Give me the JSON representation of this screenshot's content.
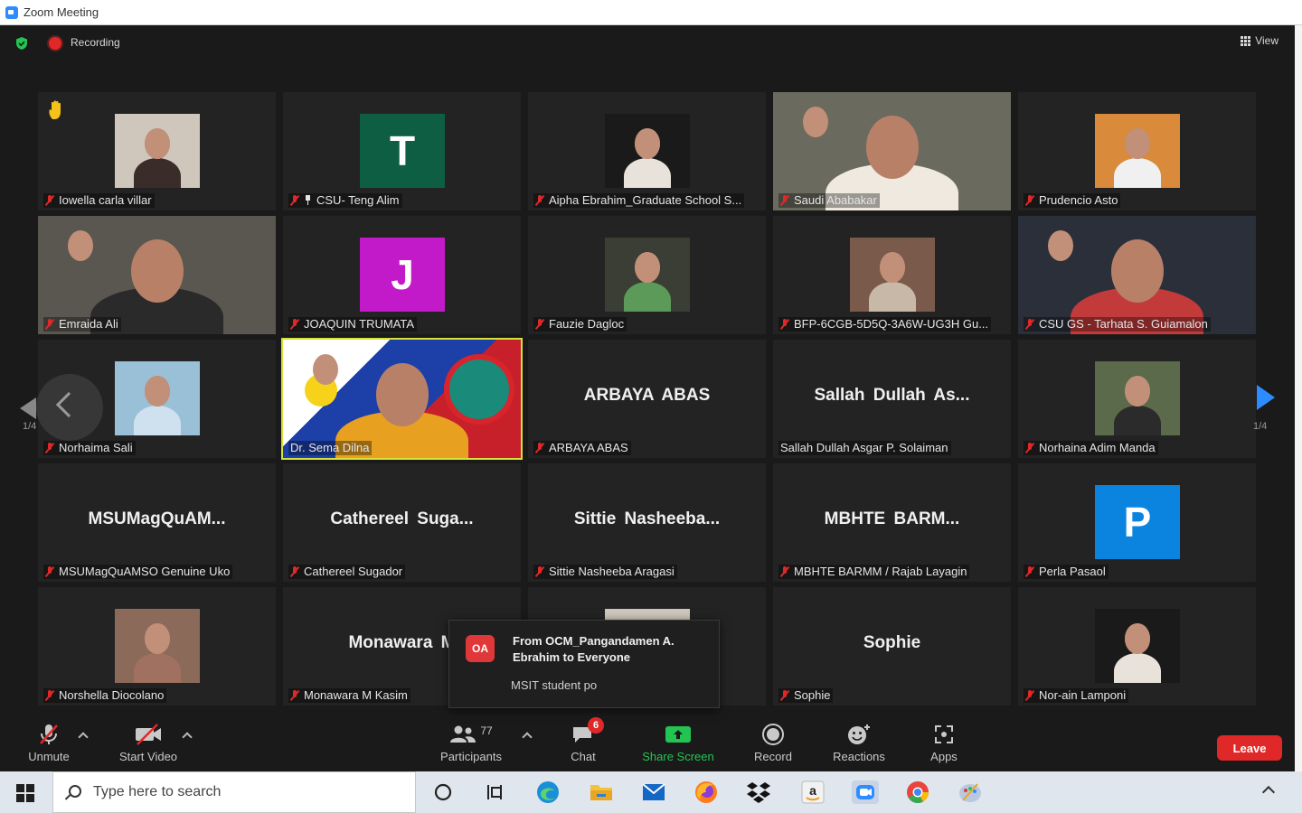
{
  "window": {
    "title": "Zoom Meeting"
  },
  "topbar": {
    "recording_label": "Recording",
    "view_label": "View"
  },
  "participants_grid": [
    {
      "name": "Iowella carla villar",
      "type": "photo",
      "raised_hand": true,
      "muted": true
    },
    {
      "name": "CSU- Teng Alim",
      "type": "letter",
      "letter": "T",
      "color": "#0e5e44",
      "muted": true,
      "pinned": true
    },
    {
      "name": "Aipha Ebrahim_Graduate School S...",
      "type": "photo",
      "muted": true
    },
    {
      "name": "Saudi Ababakar",
      "type": "video",
      "muted": true
    },
    {
      "name": "Prudencio Asto",
      "type": "photo",
      "muted": true
    },
    {
      "name": "Emraida Ali",
      "type": "video",
      "muted": true
    },
    {
      "name": "JOAQUIN TRUMATA",
      "type": "letter",
      "letter": "J",
      "color": "#c21ac8",
      "muted": true
    },
    {
      "name": "Fauzie Dagloc",
      "type": "photo",
      "muted": true
    },
    {
      "name": "BFP-6CGB-5D5Q-3A6W-UG3H Gu...",
      "type": "photo",
      "muted": true
    },
    {
      "name": "CSU GS - Tarhata S. Guiamalon",
      "type": "video",
      "muted": true
    },
    {
      "name": "Norhaima Sali",
      "type": "photo",
      "muted": true
    },
    {
      "name": "Dr. Sema Dilna",
      "type": "video",
      "muted": false,
      "active_speaker": true
    },
    {
      "name": "ARBAYA ABAS",
      "type": "name",
      "display": "ARBAYA ABAS",
      "muted": true
    },
    {
      "name": "Sallah Dullah Asgar P. Solaiman",
      "type": "name",
      "display": "Sallah Dullah As...",
      "muted": false
    },
    {
      "name": "Norhaina Adim Manda",
      "type": "photo",
      "muted": true
    },
    {
      "name": "MSUMagQuAMSO Genuine Uko",
      "type": "name",
      "display": "MSUMagQuAM...",
      "muted": true
    },
    {
      "name": "Cathereel Sugador",
      "type": "name",
      "display": "Cathereel Suga...",
      "muted": true
    },
    {
      "name": "Sittie Nasheeba Aragasi",
      "type": "name",
      "display": "Sittie Nasheeba...",
      "muted": true
    },
    {
      "name": "MBHTE BARMM / Rajab Layagin",
      "type": "name",
      "display": "MBHTE BARM...",
      "muted": true
    },
    {
      "name": "Perla Pasaol",
      "type": "letter",
      "letter": "P",
      "color": "#0b84e0",
      "muted": true
    },
    {
      "name": "Norshella Diocolano",
      "type": "photo",
      "muted": true
    },
    {
      "name": "Monawara M Kasim",
      "type": "name",
      "display": "Monawara M",
      "muted": true
    },
    {
      "name": "",
      "type": "photo",
      "muted": true
    },
    {
      "name": "Sophie",
      "type": "name",
      "display": "Sophie",
      "muted": true
    },
    {
      "name": "Nor-ain Lamponi",
      "type": "photo",
      "muted": true
    }
  ],
  "pagination": {
    "left_page": "1/4",
    "right_page": "1/4"
  },
  "chat_toast": {
    "avatar_initials": "OA",
    "from": "From OCM_Pangandamen A. Ebrahim to Everyone",
    "message": "MSIT student po"
  },
  "toolbar": {
    "unmute": "Unmute",
    "start_video": "Start Video",
    "participants": "Participants",
    "participants_count": "77",
    "chat": "Chat",
    "chat_badge": "6",
    "share_screen": "Share Screen",
    "record": "Record",
    "reactions": "Reactions",
    "apps": "Apps",
    "leave": "Leave"
  },
  "taskbar": {
    "search_placeholder": "Type here to search",
    "apps": [
      "task-view",
      "widgets",
      "edge",
      "file-explorer",
      "mail",
      "firefox",
      "dropbox",
      "amazon",
      "zoom",
      "chrome",
      "paint"
    ]
  },
  "colors": {
    "accent": "#2d8cff",
    "leave": "#e02828",
    "active_speaker": "#d6e23a",
    "share": "#23c552"
  }
}
